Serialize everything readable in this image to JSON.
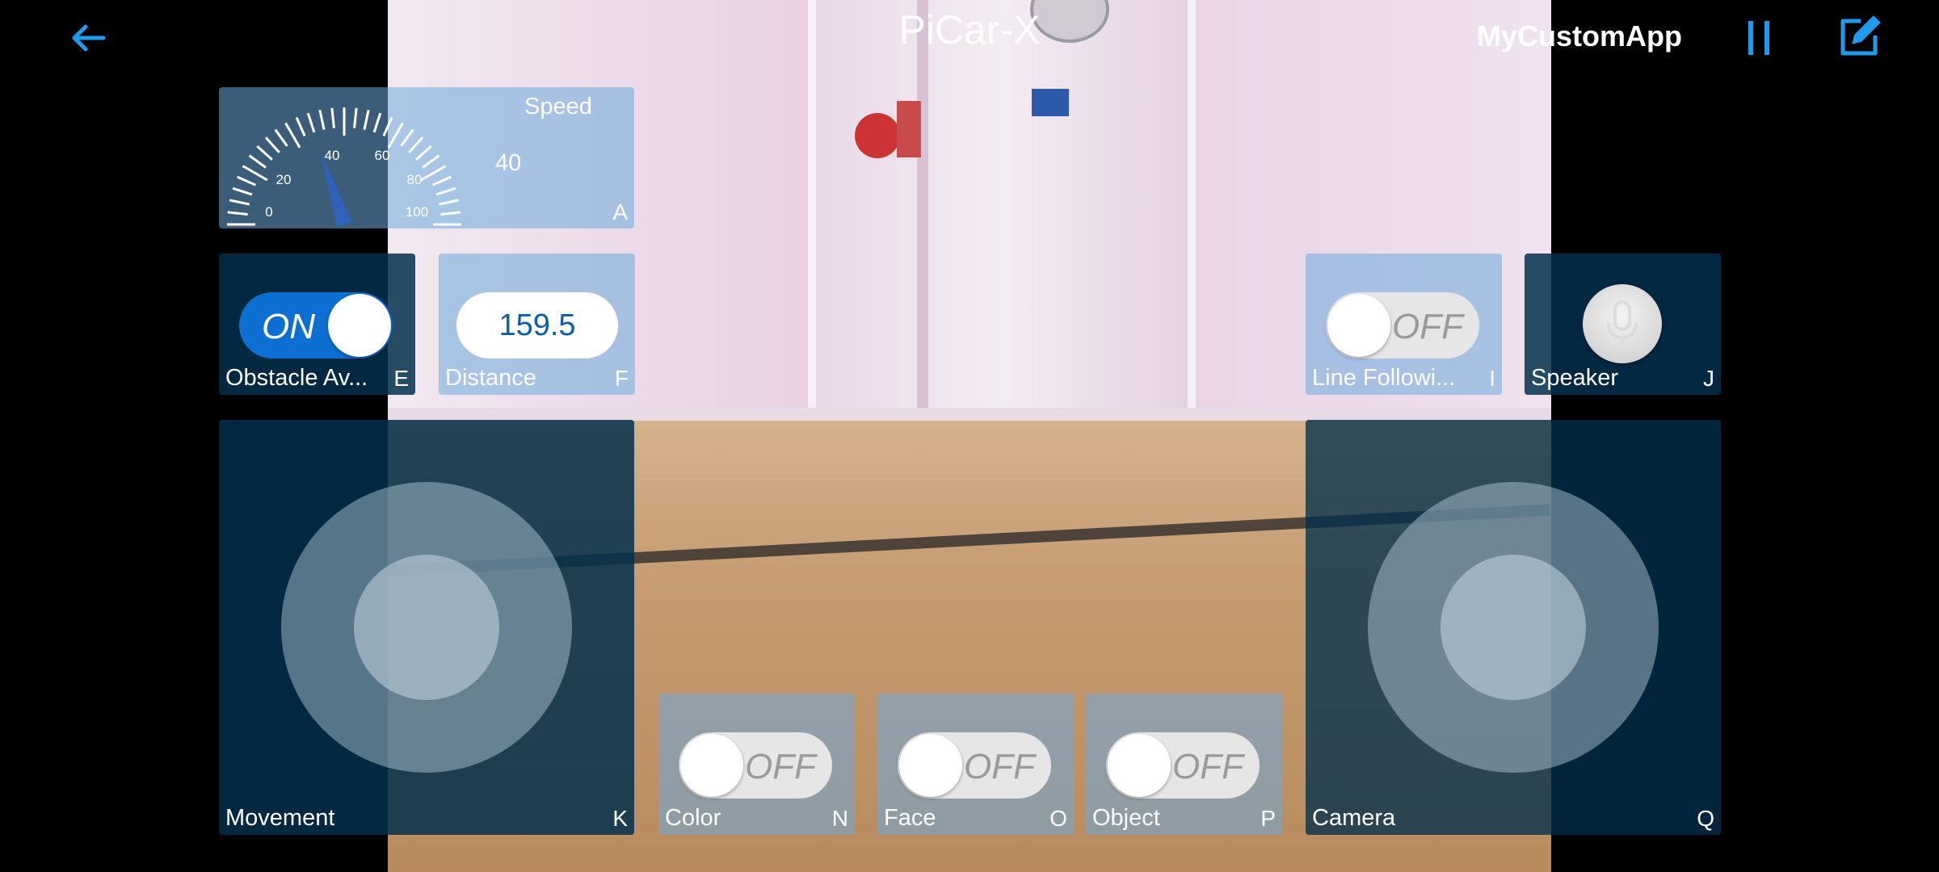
{
  "header": {
    "title": "PiCar-X",
    "app_name": "MyCustomApp",
    "back_icon": "arrow-left-icon",
    "pause_icon": "pause-icon",
    "edit_icon": "edit-icon"
  },
  "colors": {
    "accent": "#1e9bea",
    "widget_bg": "#02304c",
    "toggle_on": "#0d6fd1",
    "toggle_off": "#e6e6e6"
  },
  "speed": {
    "label": "Speed",
    "value": "40",
    "letter": "A",
    "ticks": [
      "0",
      "20",
      "40",
      "60",
      "80",
      "100"
    ],
    "level": 40
  },
  "obstacle": {
    "label": "Obstacle Av...",
    "letter": "E",
    "state": "ON"
  },
  "distance": {
    "label": "Distance",
    "letter": "F",
    "value": "159.5"
  },
  "line_following": {
    "label": "Line Followi...",
    "letter": "I",
    "state": "OFF"
  },
  "speaker": {
    "label": "Speaker",
    "letter": "J",
    "icon": "microphone-icon"
  },
  "movement": {
    "label": "Movement",
    "letter": "K"
  },
  "color": {
    "label": "Color",
    "letter": "N",
    "state": "OFF"
  },
  "face": {
    "label": "Face",
    "letter": "O",
    "state": "OFF"
  },
  "object": {
    "label": "Object",
    "letter": "P",
    "state": "OFF"
  },
  "camera": {
    "label": "Camera",
    "letter": "Q"
  }
}
